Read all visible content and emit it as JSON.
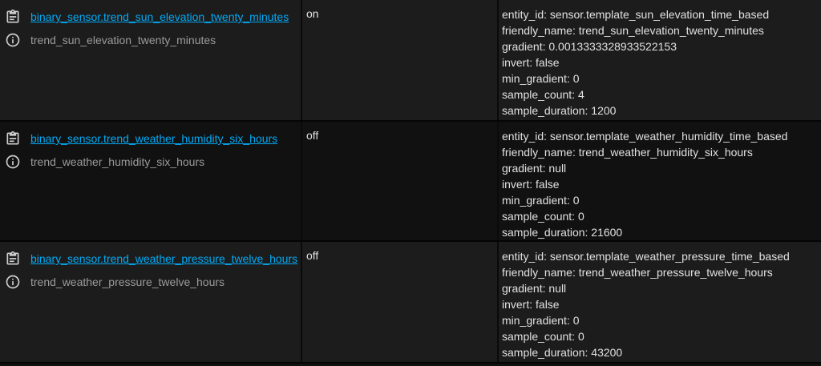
{
  "rows": [
    {
      "entity_id": "binary_sensor.trend_sun_elevation_twenty_minutes",
      "friendly_name": "trend_sun_elevation_twenty_minutes",
      "state": "on",
      "attributes": [
        "entity_id: sensor.template_sun_elevation_time_based",
        "friendly_name: trend_sun_elevation_twenty_minutes",
        "gradient: 0.0013333328933522153",
        "invert: false",
        "min_gradient: 0",
        "sample_count: 4",
        "sample_duration: 1200"
      ]
    },
    {
      "entity_id": "binary_sensor.trend_weather_humidity_six_hours",
      "friendly_name": "trend_weather_humidity_six_hours",
      "state": "off",
      "attributes": [
        "entity_id: sensor.template_weather_humidity_time_based",
        "friendly_name: trend_weather_humidity_six_hours",
        "gradient: null",
        "invert: false",
        "min_gradient: 0",
        "sample_count: 0",
        "sample_duration: 21600"
      ]
    },
    {
      "entity_id": "binary_sensor.trend_weather_pressure_twelve_hours",
      "friendly_name": "trend_weather_pressure_twelve_hours",
      "state": "off",
      "attributes": [
        "entity_id: sensor.template_weather_pressure_time_based",
        "friendly_name: trend_weather_pressure_twelve_hours",
        "gradient: null",
        "invert: false",
        "min_gradient: 0",
        "sample_count: 0",
        "sample_duration: 43200"
      ]
    }
  ],
  "icons": {
    "copy": "clipboard-icon",
    "info": "info-circle-icon"
  },
  "colors": {
    "link": "#03a9f4",
    "text": "#e1e1e1",
    "secondary_text": "#9b9b9b",
    "row_dark": "#111111",
    "row_light": "#1c1c1c"
  }
}
